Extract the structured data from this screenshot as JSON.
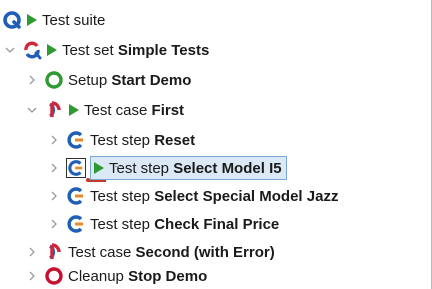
{
  "tree": {
    "rows": [
      {
        "type": "Test suite",
        "name": ""
      },
      {
        "type": "Test set",
        "name": "Simple Tests"
      },
      {
        "type": "Setup",
        "name": "Start Demo"
      },
      {
        "type": "Test case",
        "name": "First"
      },
      {
        "type": "Test step",
        "name": "Reset"
      },
      {
        "type": "Test step",
        "name": "Select Model I5"
      },
      {
        "type": "Test step",
        "name": "Select Special Model Jazz"
      },
      {
        "type": "Test step",
        "name": "Check Final Price"
      },
      {
        "type": "Test case",
        "name": "Second (with Error)"
      },
      {
        "type": "Cleanup",
        "name": "Stop Demo"
      }
    ],
    "selected_index": 5
  },
  "colors": {
    "qf_blue": "#1f5fb8",
    "qf_red": "#d0283a",
    "play_green": "#2e9a32",
    "setup_green": "#2e9a32",
    "cleanup_red": "#c8102e",
    "step_blue": "#1f5fb8",
    "step_orange": "#e8892b",
    "selection_bg": "#dbe9f7",
    "selection_border": "#7aa7d6"
  },
  "icons": {
    "suite": "test-suite-icon",
    "set": "test-set-icon",
    "case": "test-case-icon",
    "step": "test-step-icon",
    "setup": "setup-icon",
    "cleanup": "cleanup-icon",
    "play": "play-icon",
    "expand": "chevron-down-icon",
    "collapse": "chevron-right-icon"
  }
}
